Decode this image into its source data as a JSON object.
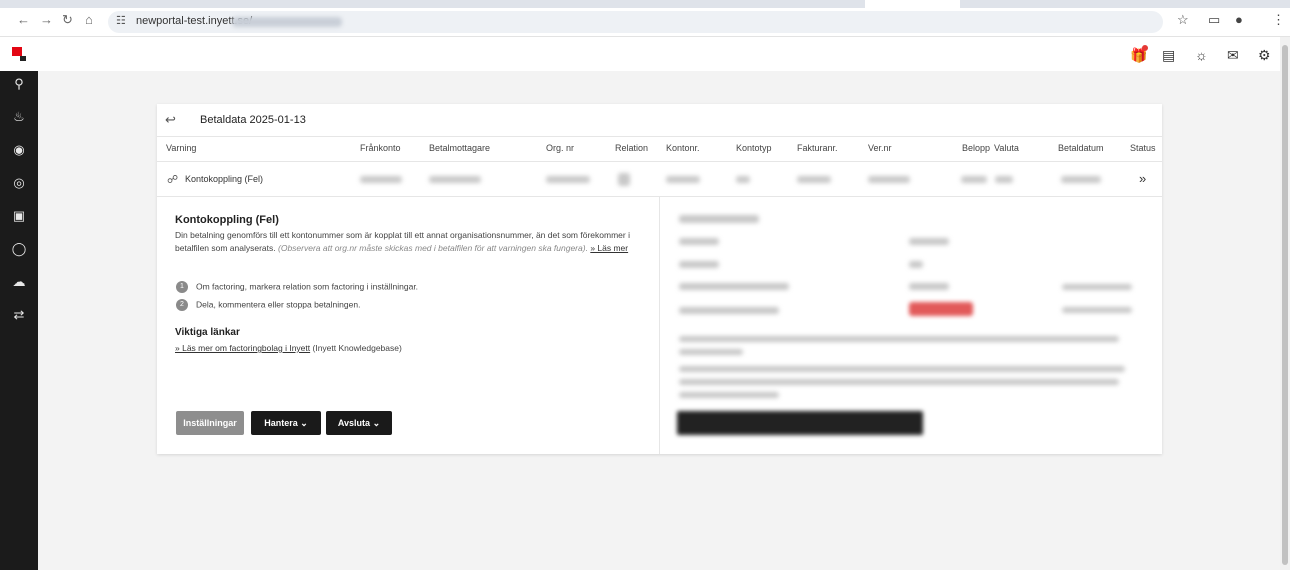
{
  "browser": {
    "url": "newportal-test.inyett.se/",
    "back_icon": "arrow-left",
    "forward_icon": "arrow-right",
    "reload_icon": "reload",
    "home_icon": "home",
    "star_icon": "star",
    "extensions_icon": "puzzle",
    "menu_icon": "kebab"
  },
  "header": {
    "icons": [
      "gift-icon",
      "calendar-icon",
      "lightbulb-icon",
      "chat-icon",
      "gear-icon"
    ],
    "notification_color": "#e53935"
  },
  "sidebar": {
    "items": [
      "search-icon",
      "bell-icon",
      "analytics-icon",
      "fingerprint-icon",
      "clipboard-icon",
      "database-icon",
      "cloud-icon",
      "transfer-icon"
    ]
  },
  "card": {
    "title": "Betaldata 2025-01-13",
    "columns": [
      "Varning",
      "Frånkonto",
      "Betalmottagare",
      "Org. nr",
      "Relation",
      "Kontonr.",
      "Kontotyp",
      "Fakturanr.",
      "Ver.nr",
      "Belopp",
      "Valuta",
      "Betaldatum",
      "Status"
    ],
    "row": {
      "warning": "Kontokoppling (Fel)"
    }
  },
  "detail": {
    "heading": "Kontokoppling (Fel)",
    "description": "Din betalning genomförs till ett kontonummer som är kopplat till ett annat organisationsnummer, än det som förekommer i betalfilen som analyserats.",
    "note": "(Observera att org.nr måste skickas med i betalfilen för att varningen ska fungera).",
    "read_more": "» Läs mer",
    "steps": [
      {
        "num": "1",
        "text": "Om factoring, markera relation som factoring i inställningar."
      },
      {
        "num": "2",
        "text": "Dela, kommentera eller stoppa betalningen."
      }
    ],
    "links_heading": "Viktiga länkar",
    "kb_link": "» Läs mer om factoringbolag i Inyett",
    "kb_suffix": "(Inyett Knowledgebase)"
  },
  "buttons": {
    "settings": "Inställningar",
    "manage": "Hantera",
    "close": "Avsluta"
  },
  "colors": {
    "brand": "#e30613",
    "sidebar": "#1b1b1b",
    "button_dark": "#1a1a1a",
    "button_disabled": "#8e8e8e"
  }
}
